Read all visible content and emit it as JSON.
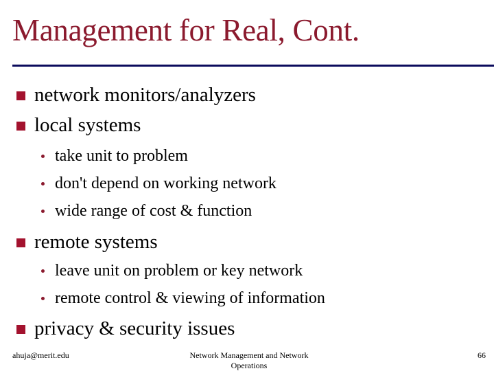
{
  "slide": {
    "title": "Management for Real, Cont.",
    "bullets": [
      {
        "text": "network monitors/analyzers",
        "sub": []
      },
      {
        "text": "local systems",
        "sub": [
          "take unit to problem",
          "don't depend on working network",
          "wide range of cost & function"
        ]
      },
      {
        "text": "remote systems",
        "sub": [
          "leave unit on problem or key network",
          "remote control & viewing of information"
        ]
      },
      {
        "text": "privacy & security issues",
        "sub": []
      }
    ]
  },
  "footer": {
    "left": "ahuja@merit.edu",
    "center_line1": "Network Management and Network",
    "center_line2": "Operations",
    "page_number": "66"
  },
  "colors": {
    "title": "#8b1a2e",
    "bullet": "#a3122e",
    "rule": "#0b0b5c"
  }
}
